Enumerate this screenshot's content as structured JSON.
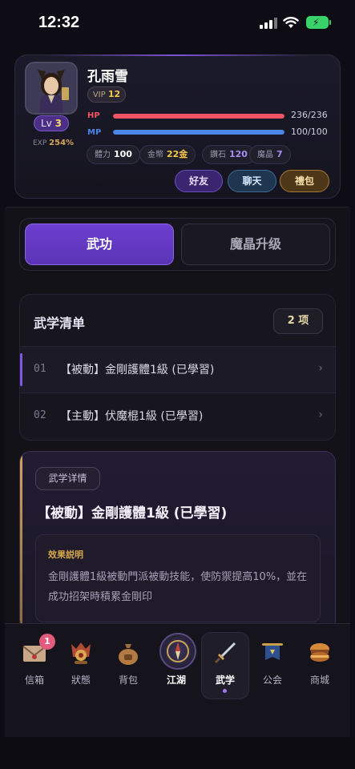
{
  "status_bar": {
    "time": "12:32"
  },
  "profile": {
    "name": "孔雨雪",
    "vip_label": "VIP",
    "vip_level": "12",
    "level_label": "Lv",
    "level": "3",
    "exp_label": "EXP",
    "exp_value": "254%",
    "hp": {
      "label": "HP",
      "text": "236/236",
      "fraction": 1.0,
      "color": "#ef5462"
    },
    "mp": {
      "label": "MP",
      "text": "100/100",
      "fraction": 1.0,
      "color": "#4a86e8"
    },
    "stats": [
      {
        "label": "體力",
        "value": "100",
        "color": "#ffffff"
      },
      {
        "label": "金幣",
        "value": "22金",
        "color": "#f5c84a"
      },
      {
        "label": "鑽石",
        "value": "120",
        "color": "#a98cf5"
      },
      {
        "label": "魔晶",
        "value": "7",
        "color": "#a98cf5"
      }
    ],
    "buttons": [
      {
        "label": "好友"
      },
      {
        "label": "聊天"
      },
      {
        "label": "禮包"
      }
    ]
  },
  "tabs": [
    {
      "label": "武功",
      "active": true
    },
    {
      "label": "魔晶升级",
      "active": false
    }
  ],
  "skill_list": {
    "title": "武学清单",
    "count": "2 项",
    "items": [
      {
        "index": "01",
        "name": "【被動】金剛護體1級 (已學習)",
        "chevron": "›"
      },
      {
        "index": "02",
        "name": "【主動】伏魔棍1級 (已學習)",
        "chevron": "›"
      }
    ]
  },
  "detail": {
    "tag": "武学详情",
    "title": "【被動】金剛護體1級 (已學習)",
    "effect_label": "效果説明",
    "effect_text": "金剛護體1級被動門派被動技能，使防禦提高10%，並在成功招架時積累金剛印"
  },
  "nav": {
    "items": [
      {
        "label": "信箱",
        "icon": "mail-icon"
      },
      {
        "label": "狀態",
        "icon": "status-icon"
      },
      {
        "label": "背包",
        "icon": "bag-icon"
      },
      {
        "label": "江湖",
        "icon": "compass-icon"
      },
      {
        "label": "武学",
        "icon": "sword-icon"
      },
      {
        "label": "公会",
        "icon": "guild-banner-icon"
      },
      {
        "label": "商城",
        "icon": "shop-icon"
      }
    ],
    "mail_badge": "1"
  }
}
